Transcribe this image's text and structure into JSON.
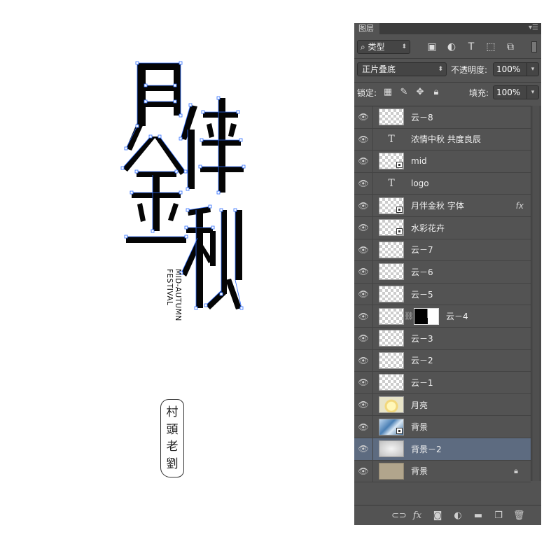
{
  "artwork": {
    "title_chars": [
      "月",
      "伴",
      "金",
      "秋"
    ],
    "subtitle_lines": [
      "MID-AUTUMN",
      "FESTIVAL"
    ],
    "seal_chars": [
      "村",
      "頭",
      "老",
      "劉"
    ]
  },
  "panel": {
    "tab_title": "图层",
    "menu_icon": "panel-menu-icon",
    "filter": {
      "label": "类型",
      "icons": [
        "image-filter-icon",
        "adjustment-filter-icon",
        "type-filter-icon",
        "shape-filter-icon",
        "smartobject-filter-icon"
      ],
      "type_glyph": "T"
    },
    "blend_mode": "正片叠底",
    "opacity_label": "不透明度:",
    "opacity_value": "100%",
    "lock_label": "锁定:",
    "fill_label": "填充:",
    "fill_value": "100%",
    "layers": [
      {
        "name": "云－8",
        "thumb": "transparent",
        "smart": false
      },
      {
        "name": "浓情中秋 共度良辰",
        "thumb": "type",
        "glyph": "T"
      },
      {
        "name": "mid",
        "thumb": "transparent",
        "smart": true
      },
      {
        "name": "logo",
        "thumb": "type",
        "glyph": "T"
      },
      {
        "name": "月伴金秋 字体",
        "thumb": "transparent",
        "smart": true,
        "fx": "fx"
      },
      {
        "name": "水彩花卉",
        "thumb": "transparent",
        "smart": true
      },
      {
        "name": "云－7",
        "thumb": "transparent"
      },
      {
        "name": "云－6",
        "thumb": "transparent"
      },
      {
        "name": "云－5",
        "thumb": "transparent"
      },
      {
        "name": "云－4",
        "thumb": "transparent",
        "mask": true
      },
      {
        "name": "云－3",
        "thumb": "transparent"
      },
      {
        "name": "云－2",
        "thumb": "transparent"
      },
      {
        "name": "云－1",
        "thumb": "transparent"
      },
      {
        "name": "月亮",
        "thumb": "moon"
      },
      {
        "name": "背景",
        "thumb": "blue",
        "smart": true
      },
      {
        "name": "背景－2",
        "thumb": "cloudy",
        "selected": true
      },
      {
        "name": "背景",
        "thumb": "tan",
        "locked": true
      }
    ],
    "footer_icons": [
      "link-layers-icon",
      "fx-icon",
      "mask-icon",
      "adjustment-icon",
      "group-folder-icon",
      "new-layer-icon",
      "trash-icon"
    ],
    "footer_fx_text": "fx"
  },
  "colors": {
    "panel_bg": "#535353",
    "selected_row": "#5d6b80",
    "path_anchor": "#2b6bff"
  }
}
